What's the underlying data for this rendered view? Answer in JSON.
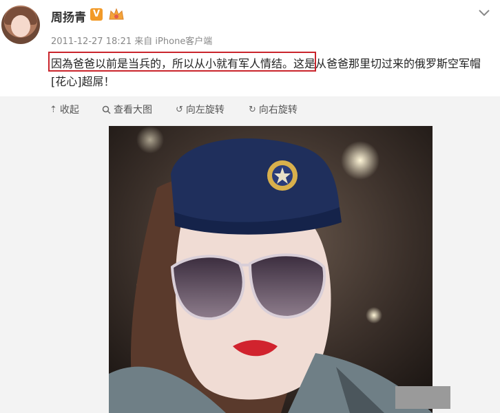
{
  "user": {
    "name": "周扬青",
    "badge": "V"
  },
  "meta": {
    "time": "2011-12-27 18:21",
    "source": "来自 iPhone客户端"
  },
  "post": {
    "highlighted": "因為爸爸以前是当兵的，所以从小就有军人情结。",
    "rest": "这是从爸爸那里切过来的俄罗斯空军帽[花心]超屌！"
  },
  "toolbar": {
    "collapse": "收起",
    "view_large": "查看大图",
    "rotate_left": "向左旋转",
    "rotate_right": "向右旋转"
  },
  "colors": {
    "highlight_border": "#c9242b",
    "vip_badge": "#f29a28"
  },
  "icons": [
    "avatar",
    "vip-badge-icon",
    "crown-icon",
    "chevron-down-icon",
    "collapse-icon",
    "magnify-icon",
    "rotate-left-icon",
    "rotate-right-icon"
  ]
}
